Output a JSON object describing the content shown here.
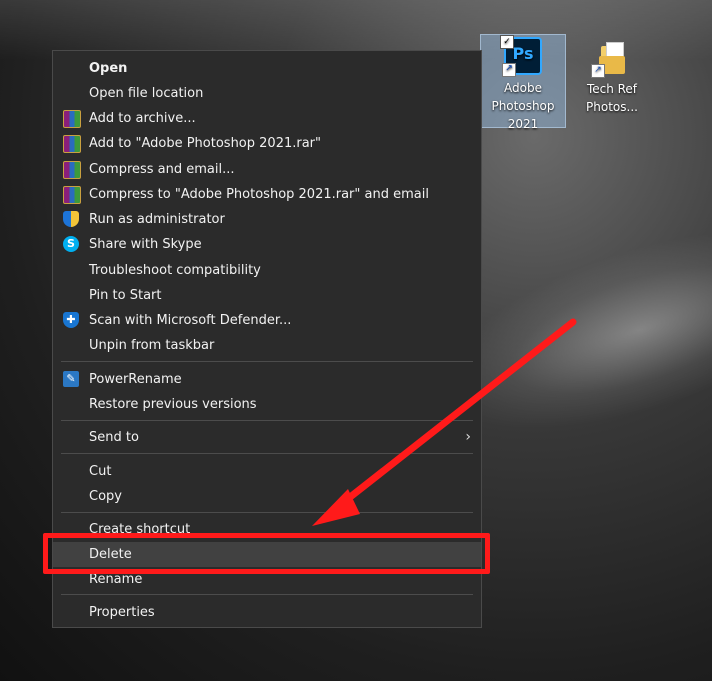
{
  "desktop": {
    "icons": [
      {
        "label_lines": [
          "Adobe",
          "Photoshop",
          "2021"
        ],
        "icon": "photoshop-icon",
        "selected": true
      },
      {
        "label_lines": [
          "Tech Ref",
          "Photos..."
        ],
        "icon": "folder-icon",
        "selected": false
      }
    ]
  },
  "context_menu": {
    "items": [
      {
        "label": "Open",
        "icon": "",
        "bold": true
      },
      {
        "label": "Open file location",
        "icon": ""
      },
      {
        "label": "Add to archive...",
        "icon": "winrar-icon"
      },
      {
        "label": "Add to \"Adobe Photoshop 2021.rar\"",
        "icon": "winrar-icon"
      },
      {
        "label": "Compress and email...",
        "icon": "winrar-icon"
      },
      {
        "label": "Compress to \"Adobe Photoshop 2021.rar\" and email",
        "icon": "winrar-icon"
      },
      {
        "label": "Run as administrator",
        "icon": "uac-shield-icon"
      },
      {
        "label": "Share with Skype",
        "icon": "skype-icon"
      },
      {
        "label": "Troubleshoot compatibility",
        "icon": ""
      },
      {
        "label": "Pin to Start",
        "icon": ""
      },
      {
        "label": "Scan with Microsoft Defender...",
        "icon": "defender-icon"
      },
      {
        "label": "Unpin from taskbar",
        "icon": ""
      },
      {
        "label": "PowerRename",
        "icon": "powerrename-icon"
      },
      {
        "label": "Restore previous versions",
        "icon": ""
      },
      {
        "label": "Send to",
        "icon": "",
        "submenu": true
      },
      {
        "label": "Cut",
        "icon": ""
      },
      {
        "label": "Copy",
        "icon": ""
      },
      {
        "label": "Create shortcut",
        "icon": ""
      },
      {
        "label": "Delete",
        "icon": "",
        "hovered": true
      },
      {
        "label": "Rename",
        "icon": ""
      },
      {
        "label": "Properties",
        "icon": ""
      }
    ]
  },
  "annotation": {
    "highlight_color": "#ff1a1a",
    "arrow_color": "#ff1a1a",
    "target": "Delete"
  },
  "icons": {
    "ps_letters": "Ps",
    "check": "✓",
    "shortcut": "↗",
    "skype_letter": "S",
    "chevron": "›"
  }
}
